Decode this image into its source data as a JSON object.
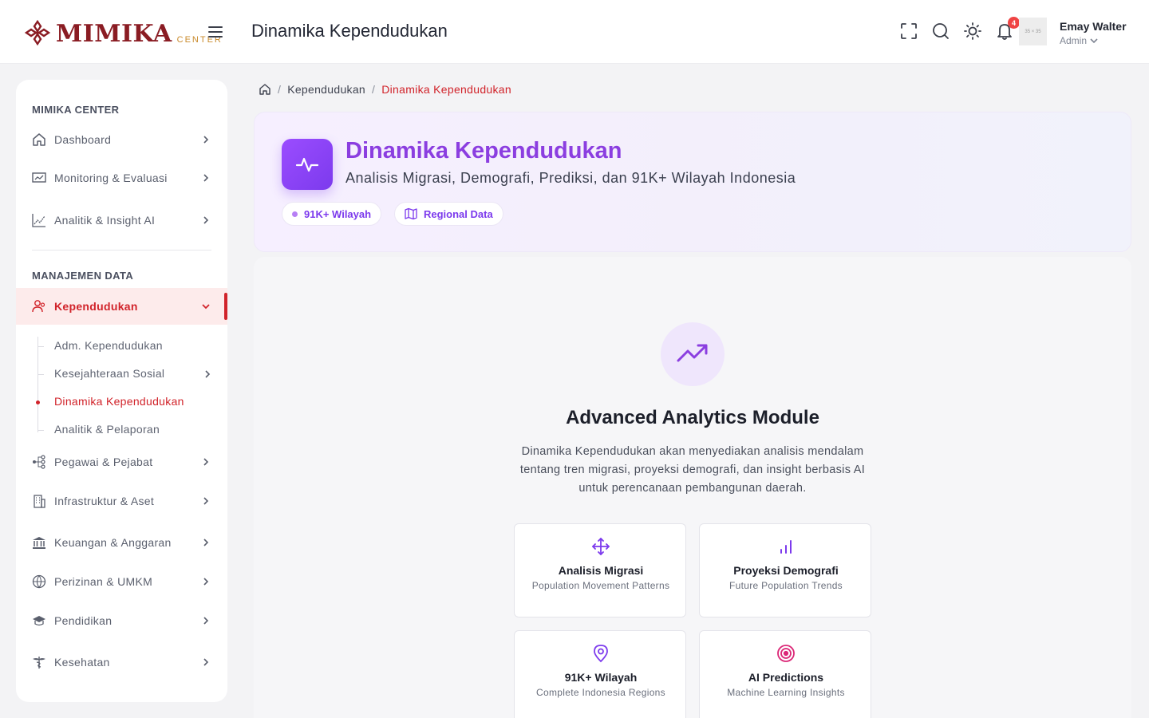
{
  "header": {
    "logo_text": "MIMIKA",
    "logo_sub": "CENTER",
    "page_title": "Dinamika Kependudukan",
    "notification_count": "4",
    "avatar_placeholder": "35 × 35",
    "user_name": "Emay Walter",
    "user_role": "Admin"
  },
  "sidebar": {
    "section1": "MIMIKA CENTER",
    "section2": "MANAJEMEN DATA",
    "items_top": [
      {
        "label": "Dashboard",
        "icon": "home-icon"
      },
      {
        "label": "Monitoring & Evaluasi",
        "icon": "monitor-chart-icon"
      },
      {
        "label": "Analitik & Insight AI",
        "icon": "line-chart-icon"
      }
    ],
    "active_item": {
      "label": "Kependudukan",
      "icon": "users-icon"
    },
    "sub_items": [
      {
        "label": "Adm. Kependudukan"
      },
      {
        "label": "Kesejahteraan Sosial"
      },
      {
        "label": "Dinamika Kependudukan"
      },
      {
        "label": "Analitik & Pelaporan"
      }
    ],
    "items_bottom": [
      {
        "label": "Pegawai & Pejabat",
        "icon": "org-tree-icon"
      },
      {
        "label": "Infrastruktur & Aset",
        "icon": "building-icon"
      },
      {
        "label": "Keuangan & Anggaran",
        "icon": "bank-icon"
      },
      {
        "label": "Perizinan & UMKM",
        "icon": "globe-icon"
      },
      {
        "label": "Pendidikan",
        "icon": "graduation-cap-icon"
      },
      {
        "label": "Kesehatan",
        "icon": "caduceus-icon"
      }
    ]
  },
  "breadcrumb": {
    "parent": "Kependudukan",
    "current": "Dinamika Kependudukan"
  },
  "hero": {
    "title": "Dinamika Kependudukan",
    "subtitle": "Analisis Migrasi, Demografi, Prediksi, dan 91K+ Wilayah Indonesia",
    "pill1": "91K+ Wilayah",
    "pill2": "Regional Data"
  },
  "module": {
    "title": "Advanced Analytics Module",
    "description": "Dinamika Kependudukan akan menyediakan analisis mendalam tentang tren migrasi, proyeksi demografi, dan insight berbasis AI untuk perencanaan pembangunan daerah.",
    "features": [
      {
        "title": "Analisis Migrasi",
        "subtitle": "Population Movement Patterns",
        "icon": "move-arrows-icon"
      },
      {
        "title": "Proyeksi Demografi",
        "subtitle": "Future Population Trends",
        "icon": "bar-chart-icon"
      },
      {
        "title": "91K+ Wilayah",
        "subtitle": "Complete Indonesia Regions",
        "icon": "map-pin-icon"
      },
      {
        "title": "AI Predictions",
        "subtitle": "Machine Learning Insights",
        "icon": "target-icon"
      }
    ]
  },
  "colors": {
    "brand": "#8a1c23",
    "accent_red": "#d1232a",
    "purple": "#7c3aed"
  }
}
